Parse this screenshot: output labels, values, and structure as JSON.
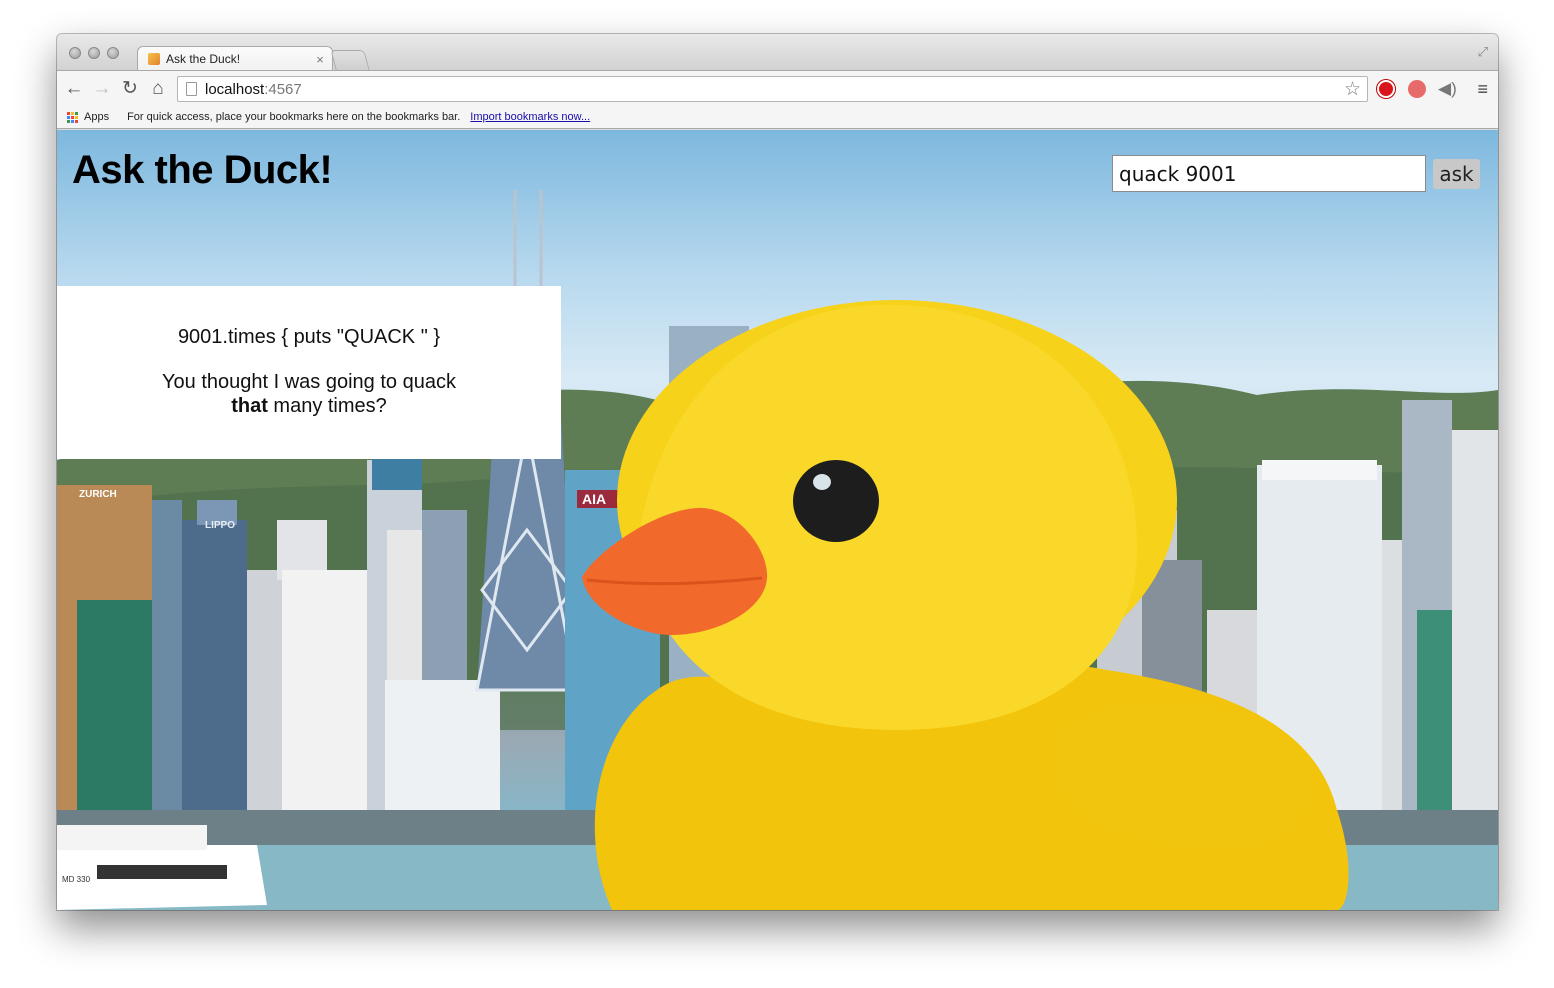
{
  "browser": {
    "tab_title": "Ask the Duck!",
    "tab_close": "×",
    "address_host": "localhost",
    "address_port": ":4567",
    "nav": {
      "back": "←",
      "forward": "→",
      "reload": "↻",
      "home": "⌂"
    },
    "star": "☆",
    "menu": "≡"
  },
  "bookmarks_bar": {
    "apps_label": "Apps",
    "hint": "For quick access, place your bookmarks here on the bookmarks bar.",
    "import_link": "Import bookmarks now..."
  },
  "page": {
    "title": "Ask the Duck!",
    "search": {
      "value": "quack 9001",
      "button_label": "ask"
    },
    "answer": {
      "code": "9001.times { puts \"QUACK \" }",
      "line1": "You thought I was going to quack",
      "emphasis": "that",
      "line2_rest": " many times?"
    },
    "background_image_text": {
      "sign_aia": "AIA",
      "sign_zurich": "ZURICH",
      "sign_lippo": "LIPPO",
      "ferry_number": "MD 330"
    }
  },
  "colors": {
    "duck_yellow": "#f7d21a",
    "beak_orange": "#f26a2b",
    "sky": "#b6d8ee",
    "water": "#7fb3c4"
  }
}
